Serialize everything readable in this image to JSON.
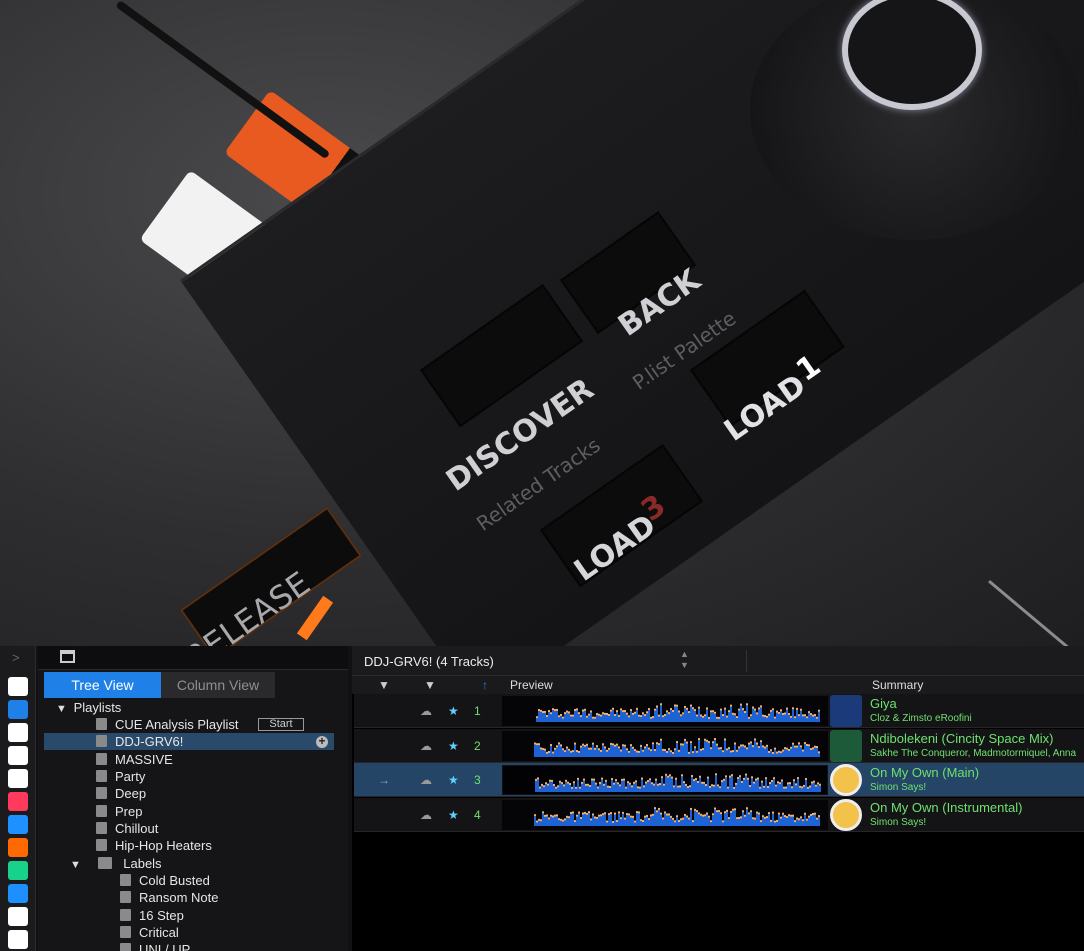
{
  "hardware": {
    "labels": {
      "discover": "DISCOVER",
      "related_tracks": "Related Tracks",
      "back": "BACK",
      "plist_palette": "P.list Palette",
      "load1_word": "LOAD",
      "load1_num": "1",
      "load3_word": "LOAD",
      "load3_num": "3",
      "release": "RELEASE"
    }
  },
  "sidebar": {
    "chevron": ">",
    "icons": [
      {
        "name": "bookmark-icon",
        "color": "#ffffff"
      },
      {
        "name": "collection-icon",
        "color": "#1f80e8"
      },
      {
        "name": "link-icon",
        "color": "#ffffff"
      },
      {
        "name": "explorer-icon",
        "color": "#ffffff"
      },
      {
        "name": "grid-icon",
        "color": "#ffffff"
      },
      {
        "name": "itunes-icon",
        "color": "#ff3a5c"
      },
      {
        "name": "streaming-icon",
        "color": "#1e90ff"
      },
      {
        "name": "soundcloud-icon",
        "color": "#ff6a00"
      },
      {
        "name": "beatsource-icon",
        "color": "#18d18a"
      },
      {
        "name": "beatport-icon",
        "color": "#1d8fff"
      },
      {
        "name": "tidal-icon",
        "color": "#ffffff"
      },
      {
        "name": "computer-icon",
        "color": "#ffffff"
      }
    ]
  },
  "tree": {
    "tabs": {
      "tree_view": "Tree View",
      "column_view": "Column View"
    },
    "start_label": "Start",
    "plus_label": "+",
    "playlists_label": "Playlists",
    "items": [
      {
        "label": "CUE Analysis Playlist"
      },
      {
        "label": "DDJ-GRV6!"
      },
      {
        "label": "MASSIVE"
      },
      {
        "label": "Party"
      },
      {
        "label": "Deep"
      },
      {
        "label": "Prep"
      },
      {
        "label": "Chillout"
      },
      {
        "label": "Hip-Hop Heaters"
      }
    ],
    "labels_folder": "Labels",
    "label_items": [
      {
        "label": "Cold Busted"
      },
      {
        "label": "Ransom Note"
      },
      {
        "label": "16 Step"
      },
      {
        "label": "Critical"
      },
      {
        "label": "UNI / UP"
      }
    ]
  },
  "main": {
    "title": "DDJ-GRV6! (4 Tracks)",
    "columns": {
      "preview": "Preview",
      "summary": "Summary"
    },
    "tracks": [
      {
        "num": "1",
        "title": "Giya",
        "artist": "Cloz & Zimsto eRoofini"
      },
      {
        "num": "2",
        "title": "Ndibolekeni (Cincity Space Mix)",
        "artist": "Sakhe The Conqueror, Madmotormiquel, Anna"
      },
      {
        "num": "3",
        "title": "On My Own (Main)",
        "artist": "Simon Says!"
      },
      {
        "num": "4",
        "title": "On My Own (Instrumental)",
        "artist": "Simon Says!"
      }
    ],
    "selected_track": 3,
    "accent_color": "#1f80e8",
    "track_text_color": "#6fe06f"
  }
}
